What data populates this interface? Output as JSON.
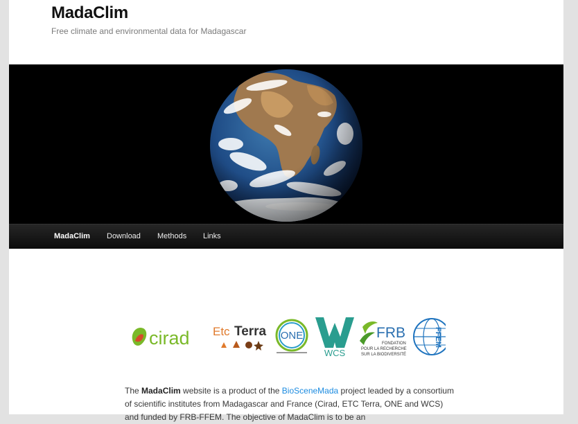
{
  "header": {
    "site_title": "MadaClim",
    "site_description": "Free climate and environmental data for Madagascar"
  },
  "nav": {
    "items": [
      {
        "label": "MadaClim",
        "active": true
      },
      {
        "label": "Download",
        "active": false
      },
      {
        "label": "Methods",
        "active": false
      },
      {
        "label": "Links",
        "active": false
      }
    ]
  },
  "logos": {
    "cirad": "cirad",
    "etc_terra_etc": "Etc",
    "etc_terra_terra": "Terra",
    "one": "ONE",
    "wcs": "WCS",
    "frb": "FRB",
    "frb_line1": "FONDATION",
    "frb_line2": "POUR LA RECHERCHE",
    "frb_line3": "SUR LA BIODIVERSITÉ",
    "ffem": "FFEM"
  },
  "intro": {
    "p1": "The ",
    "brand": "MadaClim",
    "p2": " website is a product of the ",
    "link": "BioSceneMada",
    "p3": " project leaded by a consortium of scientific institutes from Madagascar and France (Cirad, ETC Terra, ONE and WCS) and funded by FRB-FFEM. The objective of MadaClim is to be an"
  },
  "colors": {
    "link": "#1b8be0",
    "navbar": "#1a1a1a",
    "cirad_green": "#7ab929",
    "wcs_teal": "#2a9d8f",
    "ffem_blue": "#1e73be"
  }
}
